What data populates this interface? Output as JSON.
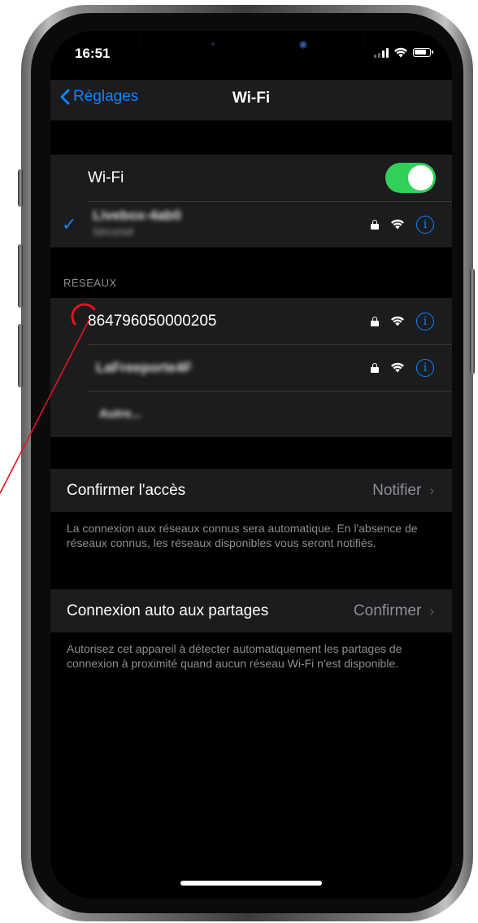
{
  "status": {
    "time": "16:51"
  },
  "nav": {
    "back_label": "Réglages",
    "title": "Wi-Fi"
  },
  "wifi": {
    "label": "Wi-Fi",
    "enabled": true,
    "connected_name": "Livebox-4ab0",
    "connected_subtitle": "Sécurisé"
  },
  "networks": {
    "header": "RÉSEAUX",
    "items": [
      {
        "name": "864796050000205",
        "locked": true,
        "blurred": false
      },
      {
        "name": "LaFreeporte4F",
        "locked": true,
        "blurred": false
      },
      {
        "name": "Autre...",
        "locked": false,
        "blurred": true
      }
    ]
  },
  "ask_join": {
    "label": "Confirmer l'accès",
    "value": "Notifier",
    "footer": "La connexion aux réseaux connus sera automatique. En l'absence de réseaux connus, les réseaux disponibles vous seront notifiés."
  },
  "auto_join": {
    "label": "Connexion auto aux partages",
    "value": "Confirmer",
    "footer": "Autorisez cet appareil à détecter automatiquement les partages de connexion à proximité quand aucun réseau Wi-Fi n'est disponible."
  },
  "colors": {
    "accent": "#0a84ff",
    "toggle_on": "#30d158",
    "annotation": "#e0141e"
  }
}
